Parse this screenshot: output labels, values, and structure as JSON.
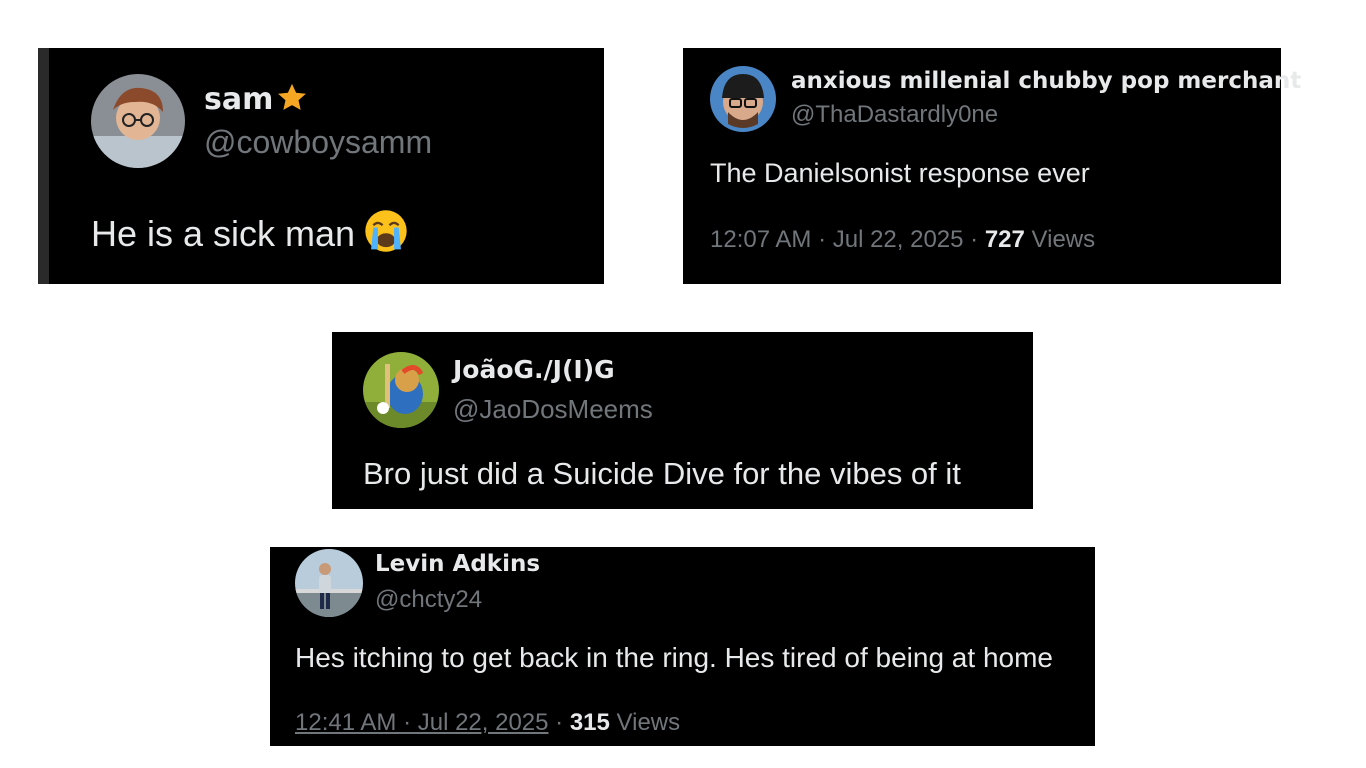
{
  "tweets": [
    {
      "name": "sam",
      "badge_icon": "star-icon",
      "handle": "@cowboysamm",
      "text": "He is a sick man",
      "emoji_icon": "loudly-crying-face-icon"
    },
    {
      "name": "anxious millenial chubby pop merchant",
      "handle": "@ThaDastardly0ne",
      "text": "The Danielsonist response ever",
      "timestamp": "12:07 AM · Jul 22, 2025",
      "separator": " · ",
      "views_count": "727",
      "views_label": " Views"
    },
    {
      "name": "JoãoG./J(I)G",
      "handle": "@JaoDosMeems",
      "text": "Bro just did a Suicide Dive for the vibes of it"
    },
    {
      "name": "Levin Adkins",
      "handle": "@chcty24",
      "text": "Hes itching to get back in the ring. Hes tired of being at home",
      "timestamp": "12:41 AM · Jul 22, 2025",
      "separator": " · ",
      "views_count": "315",
      "views_label": " Views"
    }
  ],
  "colors": {
    "card_bg": "#000000",
    "text_primary": "#e7e9ea",
    "text_secondary": "#71767b",
    "star": "#f5a623"
  }
}
